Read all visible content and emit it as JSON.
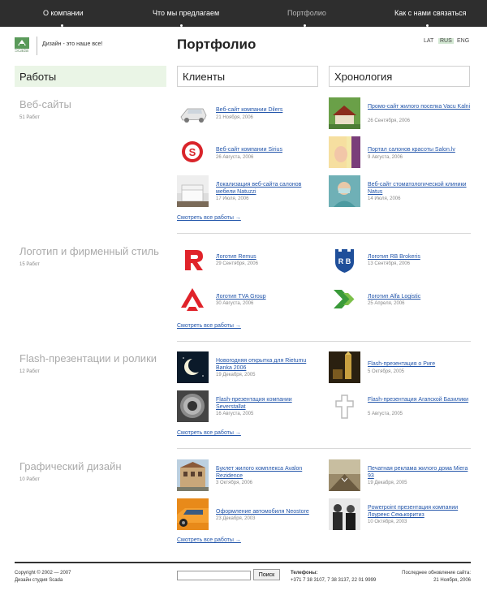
{
  "nav": {
    "items": [
      {
        "label": "О компании",
        "active": false
      },
      {
        "label": "Что мы предлагаем",
        "active": false
      },
      {
        "label": "Портфолио",
        "active": true
      },
      {
        "label": "Как с нами связаться",
        "active": false
      }
    ]
  },
  "logo": {
    "text": "Scada",
    "color": "#5a9a5a"
  },
  "tagline": "Дизайн - это наше все!",
  "page_title": "Портфолио",
  "lang": {
    "lat": "LAT",
    "rus": "RUS",
    "eng": "ENG"
  },
  "headers": {
    "works": "Работы",
    "clients": "Клиенты",
    "chronology": "Хронология"
  },
  "categories": [
    {
      "title": "Веб-сайты",
      "count": "51 Работ"
    },
    {
      "title": "Логотип и фирменный стиль",
      "count": "15 Работ"
    },
    {
      "title": "Flash-презентации и ролики",
      "count": "12 Работ"
    },
    {
      "title": "Графический дизайн",
      "count": "10 Работ"
    }
  ],
  "see_all": "Смотреть все работы →",
  "items": {
    "web": {
      "clients": [
        {
          "link": "Веб-сайт компании Dilers",
          "date": "21 Ноября, 2006"
        },
        {
          "link": "Веб-сайт компании Sirius",
          "date": "26 Августа, 2006"
        },
        {
          "link": "Локализация веб-сайта салонов мебели Natuzzi",
          "date": "17 Июля, 2006"
        }
      ],
      "chronology": [
        {
          "link": "Промо-сайт жилого поселка Vacu Kalni",
          "date": "26 Сентября, 2006"
        },
        {
          "link": "Портал салонов красоты Salon.lv",
          "date": "9 Августа, 2006"
        },
        {
          "link": "Веб-сайт стоматологической клиники Natus",
          "date": "14 Июля, 2006"
        }
      ]
    },
    "logo": {
      "clients": [
        {
          "link": "Логотип Remus",
          "date": "29 Сентября, 2006"
        },
        {
          "link": "Логотип TVA Group",
          "date": "30 Августа, 2006"
        }
      ],
      "chronology": [
        {
          "link": "Логотип RB Brokeris",
          "date": "13 Сентября, 2006"
        },
        {
          "link": "Логотип Alfa Logistic",
          "date": "25 Апреля, 2006"
        }
      ]
    },
    "flash": {
      "clients": [
        {
          "link": "Новогодняя открытка для Rietumu Banka 2006",
          "date": "19 Декабря, 2005"
        },
        {
          "link": "Flash-презентация компании Severstallat",
          "date": "16 Августа, 2005"
        }
      ],
      "chronology": [
        {
          "link": "Flash-презентация о Риге",
          "date": "5 Октября, 2005"
        },
        {
          "link": "Flash-презентация Агапской Базилики",
          "date": "5 Августа, 2005"
        }
      ]
    },
    "graphic": {
      "clients": [
        {
          "link": "Буклет жилого комплекса Avalon Rezidence",
          "date": "3 Октября, 2006"
        },
        {
          "link": "Оформление автомобиля Neostore",
          "date": "23 Декабря, 2003"
        }
      ],
      "chronology": [
        {
          "link": "Печатная реклама жилого дома Miera 93",
          "date": "19 Декабря, 2005"
        },
        {
          "link": "Powerpoint презентация компании Лоуренс Секькоритиз",
          "date": "10 Октября, 2003"
        }
      ]
    }
  },
  "footer": {
    "copyright": "Copyright © 2002 — 2007",
    "studio": "Дизайн студия Scada",
    "search_button": "Поиск",
    "phones_label": "Телефоны:",
    "phones": "+371 7 38 3107, 7 38 3137, 22 01 9999",
    "updated_label": "Последнее обновление сайта:",
    "updated_date": "21 Ноября, 2006"
  },
  "colors": {
    "accent_link": "#2255aa",
    "nav_bg": "#2e2e2e",
    "works_bg": "#eaf5e6",
    "logo_red": "#e0232a"
  }
}
